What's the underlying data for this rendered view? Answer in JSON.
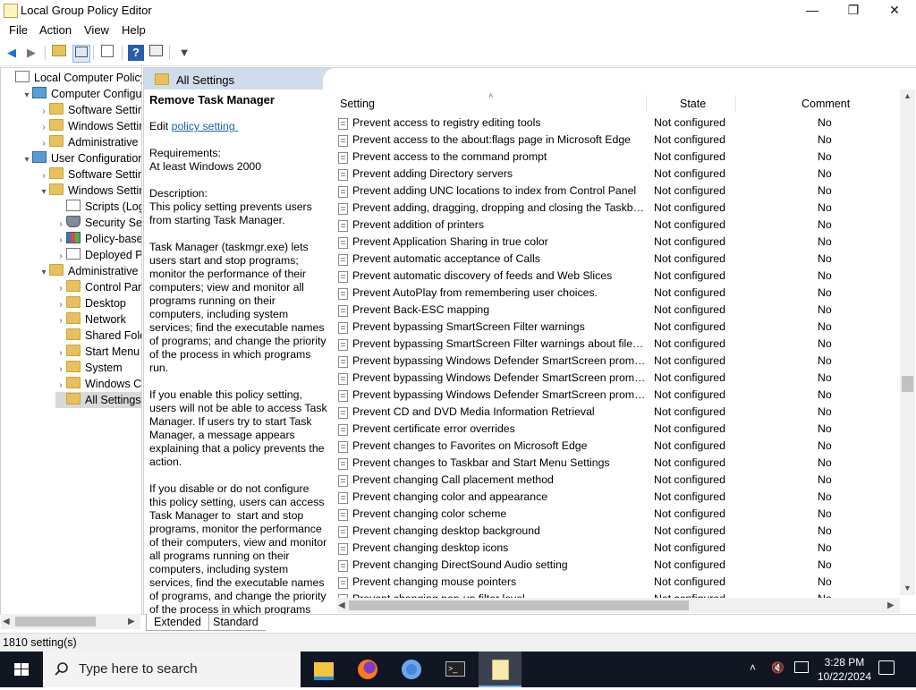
{
  "window": {
    "title": "Local Group Policy Editor",
    "min": "—",
    "max": "❐",
    "close": "✕"
  },
  "menu": [
    "File",
    "Action",
    "View",
    "Help"
  ],
  "tree": [
    {
      "label": "Local Computer Policy",
      "depth": 0,
      "expander": "",
      "icon": "doc"
    },
    {
      "label": "Computer Configura",
      "depth": 1,
      "expander": "▾",
      "icon": "pc"
    },
    {
      "label": "Software Settings",
      "depth": 2,
      "expander": "›",
      "icon": "folder"
    },
    {
      "label": "Windows Setting",
      "depth": 2,
      "expander": "›",
      "icon": "folder"
    },
    {
      "label": "Administrative Te",
      "depth": 2,
      "expander": "›",
      "icon": "folder"
    },
    {
      "label": "User Configuration",
      "depth": 1,
      "expander": "▾",
      "icon": "pc"
    },
    {
      "label": "Software Settings",
      "depth": 2,
      "expander": "›",
      "icon": "folder"
    },
    {
      "label": "Windows Setting",
      "depth": 2,
      "expander": "▾",
      "icon": "folder"
    },
    {
      "label": "Scripts (Logo",
      "depth": 3,
      "expander": "",
      "icon": "doc"
    },
    {
      "label": "Security Setti",
      "depth": 3,
      "expander": "›",
      "icon": "shield"
    },
    {
      "label": "Policy-based",
      "depth": 3,
      "expander": "›",
      "icon": "chart"
    },
    {
      "label": "Deployed Prin",
      "depth": 3,
      "expander": "›",
      "icon": "doc"
    },
    {
      "label": "Administrative Te",
      "depth": 2,
      "expander": "▾",
      "icon": "folder"
    },
    {
      "label": "Control Panel",
      "depth": 3,
      "expander": "›",
      "icon": "folder"
    },
    {
      "label": "Desktop",
      "depth": 3,
      "expander": "›",
      "icon": "folder"
    },
    {
      "label": "Network",
      "depth": 3,
      "expander": "›",
      "icon": "folder"
    },
    {
      "label": "Shared Folder",
      "depth": 3,
      "expander": "",
      "icon": "folder"
    },
    {
      "label": "Start Menu ar",
      "depth": 3,
      "expander": "›",
      "icon": "folder"
    },
    {
      "label": "System",
      "depth": 3,
      "expander": "›",
      "icon": "folder"
    },
    {
      "label": "Windows Cor",
      "depth": 3,
      "expander": "›",
      "icon": "folder"
    },
    {
      "label": "All Settings",
      "depth": 3,
      "expander": "",
      "icon": "folder",
      "selected": true
    }
  ],
  "pane": {
    "header": "All Settings"
  },
  "description": {
    "title": "Remove Task Manager",
    "edit_prefix": "Edit ",
    "edit_link": "policy setting ",
    "requirements_label": "Requirements:",
    "requirements": "At least Windows 2000",
    "description_label": "Description:",
    "p1": "This policy setting prevents users from starting Task Manager.",
    "p2": "Task Manager (taskmgr.exe) lets users start and stop programs; monitor the performance of their computers; view and monitor all programs running on their computers, including system services; find the executable names of programs; and change the priority of the process in which programs run.",
    "p3": "If you enable this policy setting, users will not be able to access Task Manager. If users try to start Task Manager, a message appears explaining that a policy prevents the action.",
    "p4": "If you disable or do not configure this policy setting, users can access Task Manager to  start and stop programs, monitor the performance of their computers, view and monitor all programs running on their computers, including system services, find the executable names of programs, and change the priority of the process in which programs run."
  },
  "columns": {
    "setting": "Setting",
    "state": "State",
    "comment": "Comment"
  },
  "rows": [
    {
      "setting": "Prevent access to registry editing tools",
      "state": "Not configured",
      "comment": "No"
    },
    {
      "setting": "Prevent access to the about:flags page in Microsoft Edge",
      "state": "Not configured",
      "comment": "No"
    },
    {
      "setting": "Prevent access to the command prompt",
      "state": "Not configured",
      "comment": "No"
    },
    {
      "setting": "Prevent adding Directory servers",
      "state": "Not configured",
      "comment": "No"
    },
    {
      "setting": "Prevent adding UNC locations to index from Control Panel",
      "state": "Not configured",
      "comment": "No"
    },
    {
      "setting": "Prevent adding, dragging, dropping and closing the Taskbar...",
      "state": "Not configured",
      "comment": "No"
    },
    {
      "setting": "Prevent addition of printers",
      "state": "Not configured",
      "comment": "No"
    },
    {
      "setting": "Prevent Application Sharing in true color",
      "state": "Not configured",
      "comment": "No"
    },
    {
      "setting": "Prevent automatic acceptance of Calls",
      "state": "Not configured",
      "comment": "No"
    },
    {
      "setting": "Prevent automatic discovery of feeds and Web Slices",
      "state": "Not configured",
      "comment": "No"
    },
    {
      "setting": "Prevent AutoPlay from remembering user choices.",
      "state": "Not configured",
      "comment": "No"
    },
    {
      "setting": "Prevent Back-ESC mapping",
      "state": "Not configured",
      "comment": "No"
    },
    {
      "setting": "Prevent bypassing SmartScreen Filter warnings",
      "state": "Not configured",
      "comment": "No"
    },
    {
      "setting": "Prevent bypassing SmartScreen Filter warnings about files th...",
      "state": "Not configured",
      "comment": "No"
    },
    {
      "setting": "Prevent bypassing Windows Defender SmartScreen prompts...",
      "state": "Not configured",
      "comment": "No"
    },
    {
      "setting": "Prevent bypassing Windows Defender SmartScreen prompts...",
      "state": "Not configured",
      "comment": "No"
    },
    {
      "setting": "Prevent bypassing Windows Defender SmartScreen prompts...",
      "state": "Not configured",
      "comment": "No"
    },
    {
      "setting": "Prevent CD and DVD Media Information Retrieval",
      "state": "Not configured",
      "comment": "No"
    },
    {
      "setting": "Prevent certificate error overrides",
      "state": "Not configured",
      "comment": "No"
    },
    {
      "setting": "Prevent changes to Favorites on Microsoft Edge",
      "state": "Not configured",
      "comment": "No"
    },
    {
      "setting": "Prevent changes to Taskbar and Start Menu Settings",
      "state": "Not configured",
      "comment": "No"
    },
    {
      "setting": "Prevent changing Call placement method",
      "state": "Not configured",
      "comment": "No"
    },
    {
      "setting": "Prevent changing color and appearance",
      "state": "Not configured",
      "comment": "No"
    },
    {
      "setting": "Prevent changing color scheme",
      "state": "Not configured",
      "comment": "No"
    },
    {
      "setting": "Prevent changing desktop background",
      "state": "Not configured",
      "comment": "No"
    },
    {
      "setting": "Prevent changing desktop icons",
      "state": "Not configured",
      "comment": "No"
    },
    {
      "setting": "Prevent changing DirectSound Audio setting",
      "state": "Not configured",
      "comment": "No"
    },
    {
      "setting": "Prevent changing mouse pointers",
      "state": "Not configured",
      "comment": "No"
    },
    {
      "setting": "Prevent changing pop-up filter level",
      "state": "Not configured",
      "comment": "No"
    }
  ],
  "tabs": {
    "extended": "Extended",
    "standard": "Standard"
  },
  "status": "1810 setting(s)",
  "taskbar": {
    "search_placeholder": "Type here to search",
    "time": "3:28 PM",
    "date": "10/22/2024",
    "apps": [
      "file-explorer",
      "firefox",
      "chromium",
      "terminal",
      "policy-editor"
    ]
  }
}
